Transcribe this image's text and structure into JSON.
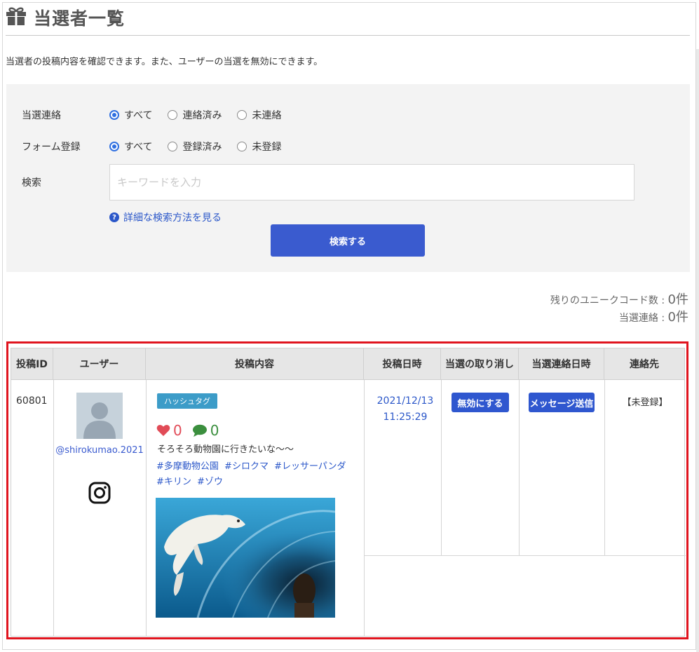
{
  "header": {
    "title": "当選者一覧"
  },
  "description": "当選者の投稿内容を確認できます。また、ユーザーの当選を無効にできます。",
  "filters": {
    "contact": {
      "label": "当選連絡",
      "options": [
        "すべて",
        "連絡済み",
        "未連絡"
      ],
      "selected": "すべて"
    },
    "form": {
      "label": "フォーム登録",
      "options": [
        "すべて",
        "登録済み",
        "未登録"
      ],
      "selected": "すべて"
    },
    "search": {
      "label": "検索",
      "placeholder": "キーワードを入力"
    },
    "help_link": "詳細な検索方法を見る",
    "search_button": "検索する"
  },
  "counts": {
    "unique_codes_label": "残りのユニークコード数 : ",
    "unique_codes_value": "0件",
    "contacted_label": "当選連絡 : ",
    "contacted_value": "0件"
  },
  "table": {
    "headers": [
      "投稿ID",
      "ユーザー",
      "投稿内容",
      "投稿日時",
      "当選の取り消し",
      "当選連絡日時",
      "連絡先"
    ],
    "row": {
      "post_id": "60801",
      "user_handle": "@shirokumao.2021",
      "tag": "ハッシュタグ",
      "likes": "0",
      "comments": "0",
      "text": "そろそろ動物園に行きたいな〜〜",
      "hashtags": [
        "#多摩動物公園",
        "#シロクマ",
        "#レッサーパンダ",
        "#キリン",
        "#ゾウ"
      ],
      "date": "2021/12/13",
      "time": "11:25:29",
      "invalidate_button": "無効にする",
      "message_button": "メッセージ送信",
      "contact": "【未登録】"
    }
  },
  "colors": {
    "primary_button": "#3a5bcf",
    "link": "#2b57c9",
    "highlight_border": "#e0141e",
    "like": "#e14b57",
    "comment": "#3b8f3e"
  },
  "icons": [
    "gift-icon",
    "question-circle-icon",
    "instagram-icon",
    "heart-icon",
    "comment-icon",
    "avatar-placeholder-icon"
  ]
}
